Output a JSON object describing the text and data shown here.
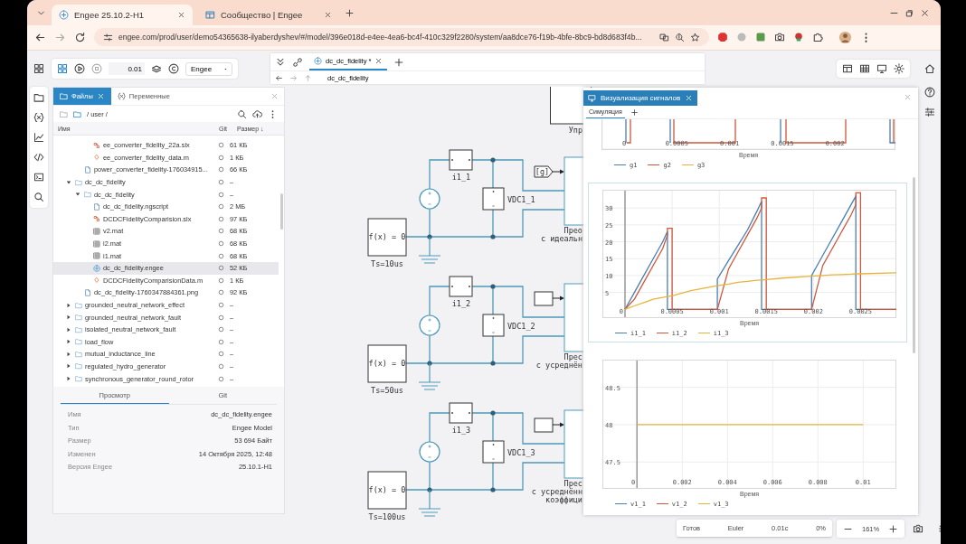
{
  "browser": {
    "tabs": [
      {
        "title": "Engee 25.10.2-H1",
        "selected": true
      },
      {
        "title": "Сообщество | Engee",
        "selected": false
      }
    ],
    "url": "engee.com/prod/user/demo54365638-ilyaberdyshev/#/model/396e018d-e4ee-4ea6-bc4f-410c329f2280/system/aa8dce76-f19b-4bfe-8bc9-bd8d683f4b..."
  },
  "toolbar": {
    "step": "0.01",
    "solver": "Engee"
  },
  "editor": {
    "tabs": [
      {
        "label": "dc_dc_fidelity *",
        "selected": true
      }
    ],
    "breadcrumb": "dc_dc_fidelity"
  },
  "files": {
    "tabs": [
      {
        "label": "Файлы",
        "selected": true
      },
      {
        "label": "Переменные",
        "selected": false
      }
    ],
    "path": "/ user /",
    "columns": [
      "Имя",
      "Git",
      "Размер ↓"
    ],
    "tree": [
      {
        "children": [
          {
            "children": [
              {
                "name": "ee_converter_fidelity_22a.slx",
                "kind": "slx",
                "size": "61 КБ",
                "selected": false
              },
              {
                "name": "ee_converter_fidelity_data.m",
                "kind": "m",
                "size": "1 КБ",
                "selected": false
              }
            ]
          },
          {
            "name": "power_converter_fidelity-176034915...",
            "kind": "png",
            "size": "66 КБ",
            "selected": false
          }
        ]
      },
      {
        "name": "dc_dc_fidelity",
        "kind": "folder",
        "expanded": true,
        "size": "–",
        "selected": false,
        "children": [
          {
            "name": "dc_dc_fidelity",
            "kind": "folder",
            "expanded": true,
            "size": "–",
            "selected": false,
            "children": [
              {
                "name": "dc_dc_fidelity.ngscript",
                "kind": "png",
                "size": "2 МБ",
                "selected": false
              },
              {
                "name": "DCDCFidelityComparision.slx",
                "kind": "slx",
                "size": "97 КБ",
                "selected": false
              },
              {
                "name": "v2.mat",
                "kind": "mat",
                "size": "68 КБ",
                "selected": false
              },
              {
                "name": "i2.mat",
                "kind": "mat",
                "size": "68 КБ",
                "selected": false
              },
              {
                "name": "i1.mat",
                "kind": "mat",
                "size": "68 КБ",
                "selected": false
              },
              {
                "name": "dc_dc_fidelity.engee",
                "kind": "engee",
                "size": "52 КБ",
                "selected": true
              },
              {
                "name": "DCDCFidelityComparisionData.m",
                "kind": "m",
                "size": "1 КБ",
                "selected": false
              }
            ]
          },
          {
            "name": "dc_dc_fidelity-1760347884361.png",
            "kind": "png",
            "size": "92 КБ",
            "selected": false
          }
        ]
      },
      {
        "name": "grounded_neutral_network_effect",
        "kind": "folder",
        "expanded": false,
        "size": "–",
        "selected": false
      },
      {
        "name": "grounded_neutral_network_fault",
        "kind": "folder",
        "expanded": false,
        "size": "–",
        "selected": false
      },
      {
        "name": "isolated_neutral_network_fault",
        "kind": "folder",
        "expanded": false,
        "size": "–",
        "selected": false
      },
      {
        "name": "load_flow",
        "kind": "folder",
        "expanded": false,
        "size": "–",
        "selected": false
      },
      {
        "name": "mutual_inductance_line",
        "kind": "folder",
        "expanded": false,
        "size": "–",
        "selected": false
      },
      {
        "name": "regulated_hydro_generator",
        "kind": "folder",
        "expanded": false,
        "size": "–",
        "selected": false
      },
      {
        "name": "synchronous_generator_round_rotor",
        "kind": "folder",
        "expanded": false,
        "size": "–",
        "selected": false
      }
    ]
  },
  "properties": {
    "tabs": [
      {
        "label": "Просмотр",
        "selected": true
      },
      {
        "label": "Git",
        "selected": false
      }
    ],
    "rows": [
      {
        "key": "Имя",
        "value": "dc_dc_fidelity.engee"
      },
      {
        "key": "Тип",
        "value": "Engee Model"
      },
      {
        "key": "Размер",
        "value": "53 694 Байт"
      },
      {
        "key": "Изменен",
        "value": "14 Октября 2025, 12:48"
      },
      {
        "key": "Версия Engee",
        "value": "25.10.1-H1"
      }
    ]
  },
  "diagram": {
    "controller_label": "Упр",
    "circuits": [
      {
        "current_label": "i1_1",
        "voltage_label": "VDC1_1",
        "function_text": "f(x) = 0",
        "sample_time": "Ts=10us",
        "goto_tag": "[g]",
        "converter_lines": [
          "Прео",
          "с идеальн"
        ]
      },
      {
        "current_label": "i1_2",
        "voltage_label": "VDC1_2",
        "function_text": "f(x) = 0",
        "sample_time": "Ts=50us",
        "converter_lines": [
          "Прес",
          "с усреднён"
        ]
      },
      {
        "current_label": "i1_3",
        "voltage_label": "VDC1_3",
        "function_text": "f(x) = 0",
        "sample_time": "Ts=100us",
        "converter_lines": [
          "Прес",
          "с усреднённ",
          "коэффици"
        ]
      }
    ]
  },
  "signals": {
    "title": "Визуализация сигналов",
    "tabs": [
      {
        "label": "Симуляция",
        "selected": true
      }
    ],
    "gate_plot": {
      "xtick_labels": [
        "0",
        "0.0005",
        "0.001",
        "0.0015",
        "0.002"
      ],
      "xlabel": "Время",
      "legend": [
        {
          "name": "g1",
          "color": "#4a7fb5"
        },
        {
          "name": "g2",
          "color": "#d0573a"
        },
        {
          "name": "g3",
          "color": "#e6b43c"
        }
      ]
    },
    "current_plot": {
      "chart_data": {
        "type": "line",
        "grid": true,
        "xlabel": "Время",
        "xlim": [
          -0.00024,
          0.00288
        ],
        "ylim": [
          -2.6,
          35.4
        ],
        "xticks": [
          0,
          0.0005,
          0.001,
          0.0015,
          0.002,
          0.0025
        ],
        "yticks": [
          5,
          10,
          15,
          20,
          25,
          30
        ],
        "x": [
          0,
          0.0001,
          0.0002,
          0.0003,
          0.0004,
          0.00045,
          0.00045,
          0.0005,
          0.0005,
          0.0007,
          0.00098,
          0.00098,
          0.0011,
          0.0012,
          0.0013,
          0.0014,
          0.00145,
          0.00145,
          0.0015,
          0.0015,
          0.0017,
          0.00198,
          0.00198,
          0.0021,
          0.0022,
          0.0023,
          0.0024,
          0.00245,
          0.00245,
          0.0025,
          0.0025,
          0.00288
        ],
        "series": [
          {
            "name": "i1_1",
            "color": "#4a7fb5",
            "values": [
              0,
              5,
              10,
              15,
              20,
              23,
              0,
              0,
              0,
              0,
              0,
              9,
              14.5,
              19,
              23.5,
              29,
              32,
              0,
              0,
              0,
              0,
              0,
              10,
              16,
              21,
              26,
              31,
              33.5,
              0,
              0,
              0,
              0
            ]
          },
          {
            "name": "i1_2",
            "color": "#d0573a",
            "values": [
              0,
              3,
              8,
              13,
              18,
              22,
              24,
              24,
              0,
              0,
              0,
              0,
              12,
              17,
              22,
              27,
              30,
              33,
              33,
              0,
              0,
              0,
              0,
              13,
              18,
              23,
              28,
              31,
              34.5,
              34.5,
              0,
              0
            ]
          },
          {
            "name": "i1_3",
            "color": "#e6b43c",
            "values": [
              0,
              1,
              2,
              3,
              3.5,
              3.8,
              3.8,
              4,
              4,
              5.5,
              7,
              7,
              7.5,
              8,
              8.3,
              8.6,
              8.7,
              8.7,
              8.8,
              8.8,
              9.3,
              9.8,
              9.8,
              10,
              10.2,
              10.3,
              10.4,
              10.5,
              10.5,
              10.5,
              10.5,
              10.8
            ]
          }
        ]
      }
    },
    "voltage_plot": {
      "chart_data": {
        "type": "line",
        "grid": true,
        "xlabel": "Время",
        "xlim": [
          -0.00153,
          0.01147
        ],
        "ylim": [
          47.14,
          48.87
        ],
        "xticks": [
          0,
          0.002,
          0.004,
          0.006,
          0.008,
          0.01
        ],
        "yticks": [
          47.5,
          48,
          48.5
        ],
        "x": [
          0,
          0.01
        ],
        "series": [
          {
            "name": "v1_1",
            "color": "#4a7fb5",
            "values": [
              null,
              null
            ]
          },
          {
            "name": "v1_2",
            "color": "#d0573a",
            "values": [
              null,
              null
            ]
          },
          {
            "name": "v1_3",
            "color": "#e6b43c",
            "values": [
              48,
              48
            ]
          }
        ]
      }
    }
  },
  "status": {
    "state": "Готов",
    "solver": "Euler",
    "time": "0.01с",
    "progress": "0%",
    "zoom": "161%"
  }
}
